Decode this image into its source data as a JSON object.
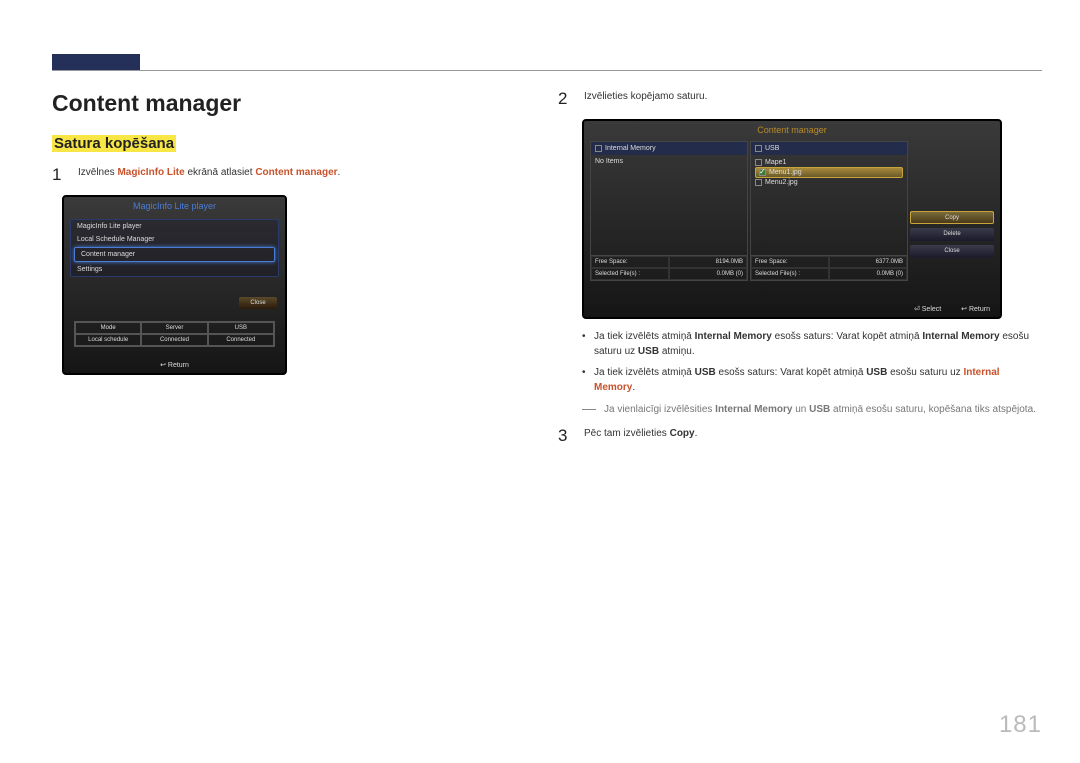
{
  "page_number": "181",
  "heading": "Content manager",
  "subheading": "Satura kopēšana",
  "left": {
    "step1": {
      "num": "1",
      "pre": "Izvēlnes ",
      "orange1": "MagicInfo Lite",
      "mid": " ekrānā atlasiet ",
      "orange2": "Content manager",
      "post": "."
    },
    "shot1": {
      "title": "MagicInfo Lite player",
      "items": [
        "MagicInfo Lite player",
        "Local Schedule Manager",
        "Content manager",
        "Settings"
      ],
      "close": "Close",
      "grid": [
        "Mode",
        "Server",
        "USB",
        "Local schedule",
        "Connected",
        "Connected"
      ],
      "return": "↩ Return"
    }
  },
  "right": {
    "step2": {
      "num": "2",
      "text": "Izvēlieties kopējamo saturu."
    },
    "shot2": {
      "title": "Content manager",
      "left_head": "Internal Memory",
      "left_body": "No Items",
      "left_free": "Free Space:",
      "left_free_v": "8194.0MB",
      "left_sel": "Selected File(s) :",
      "left_sel_v": "0.0MB (0)",
      "right_head": "USB",
      "right_items": [
        "Mape1",
        "Menu1.jpg",
        "Menu2.jpg"
      ],
      "right_free": "Free Space:",
      "right_free_v": "6377.0MB",
      "right_sel": "Selected File(s) :",
      "right_sel_v": "0.0MB (0)",
      "btns": [
        "Copy",
        "Delete",
        "Close"
      ],
      "foot_select": "⏎ Select",
      "foot_return": "↩ Return"
    },
    "bullet1": {
      "a": "Ja tiek izvēlēts atmiņā ",
      "b": "Internal Memory",
      "c": " esošs saturs: Varat kopēt atmiņā ",
      "d": "Internal Memory",
      "e": " esošu saturu uz ",
      "f": "USB",
      "g": " atmiņu."
    },
    "bullet2": {
      "a": "Ja tiek izvēlēts atmiņā ",
      "b": "USB",
      "c": " esošs saturs: Varat kopēt atmiņā ",
      "d": "USB",
      "e": " esošu saturu uz ",
      "f": "Internal Memory",
      "g": "."
    },
    "note": {
      "a": "Ja vienlaicīgi izvēlēsities ",
      "b": "Internal Memory",
      "c": " un ",
      "d": "USB",
      "e": " atmiņā esošu saturu, kopēšana tiks atspējota."
    },
    "step3": {
      "num": "3",
      "pre": "Pēc tam izvēlieties ",
      "b": "Copy",
      "post": "."
    }
  }
}
